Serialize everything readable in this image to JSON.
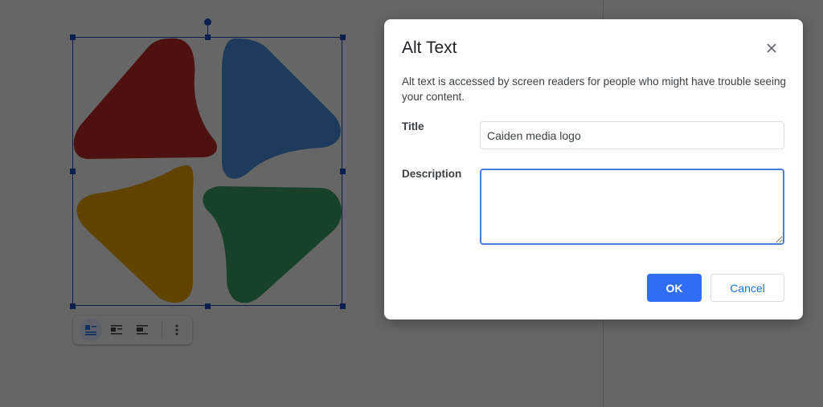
{
  "dialog": {
    "title": "Alt Text",
    "close_icon": "close-icon",
    "description": "Alt text is accessed by screen readers for people who might have trouble seeing your content.",
    "title_label": "Title",
    "title_value": "Caiden media logo",
    "description_label": "Description",
    "description_value": "",
    "ok_label": "OK",
    "cancel_label": "Cancel"
  },
  "image_toolbar": {
    "buttons": [
      "wrap-inline-icon",
      "wrap-text-icon",
      "break-text-icon"
    ],
    "more_icon": "more-vertical-icon"
  },
  "colors": {
    "logo_red": "#c62828",
    "logo_blue": "#4e95e6",
    "logo_yellow": "#f2a900",
    "logo_green": "#3aa26b",
    "accent": "#2f6ef4",
    "selection": "#1a4fc4"
  }
}
